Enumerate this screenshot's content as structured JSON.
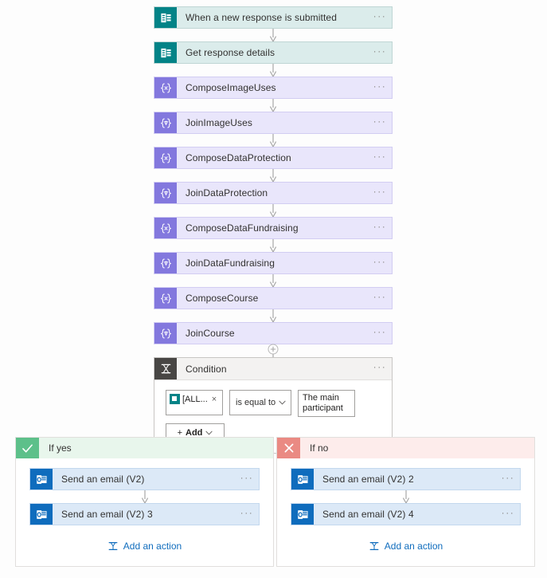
{
  "flow": {
    "steps": [
      {
        "label": "When a new response is submitted",
        "kind": "forms",
        "icon": "microsoft-forms-icon",
        "menu": "···"
      },
      {
        "label": "Get response details",
        "kind": "forms",
        "icon": "microsoft-forms-icon",
        "menu": "···"
      },
      {
        "label": "ComposeImageUses",
        "kind": "compose",
        "icon": "compose-icon",
        "menu": "···"
      },
      {
        "label": "JoinImageUses",
        "kind": "join",
        "icon": "join-icon",
        "menu": "···"
      },
      {
        "label": "ComposeDataProtection",
        "kind": "compose",
        "icon": "compose-icon",
        "menu": "···"
      },
      {
        "label": "JoinDataProtection",
        "kind": "join",
        "icon": "join-icon",
        "menu": "···"
      },
      {
        "label": "ComposeDataFundraising",
        "kind": "compose",
        "icon": "compose-icon",
        "menu": "···"
      },
      {
        "label": "JoinDataFundraising",
        "kind": "join",
        "icon": "join-icon",
        "menu": "···"
      },
      {
        "label": "ComposeCourse",
        "kind": "compose",
        "icon": "compose-icon",
        "menu": "···"
      },
      {
        "label": "JoinCourse",
        "kind": "join",
        "icon": "join-icon",
        "menu": "···"
      }
    ]
  },
  "condition": {
    "title": "Condition",
    "icon": "condition-icon",
    "menu": "···",
    "token": {
      "label": "[ALL...",
      "icon": "microsoft-forms-icon",
      "remove": "×"
    },
    "operator": {
      "value": "is equal to",
      "chevron": "chevron-down-icon"
    },
    "value": "The main participant",
    "add": {
      "plus": "+",
      "label": "Add",
      "chevron": "chevron-down-icon"
    }
  },
  "branches": {
    "yes": {
      "title": "If yes",
      "badge": "check-icon",
      "actions": [
        {
          "label": "Send an email (V2)",
          "icon": "outlook-icon",
          "menu": "···"
        },
        {
          "label": "Send an email (V2) 3",
          "icon": "outlook-icon",
          "menu": "···"
        }
      ],
      "add_action": "Add an action"
    },
    "no": {
      "title": "If no",
      "badge": "close-icon",
      "actions": [
        {
          "label": "Send an email (V2) 2",
          "icon": "outlook-icon",
          "menu": "···"
        },
        {
          "label": "Send an email (V2) 4",
          "icon": "outlook-icon",
          "menu": "···"
        }
      ],
      "add_action": "Add an action"
    }
  },
  "colors": {
    "forms": "#038387",
    "compose": "#8378de",
    "outlook": "#0f6cbd",
    "condition": "#484644",
    "yes": "#5dc08a",
    "no": "#ea8a83",
    "link": "#0f6cbd"
  }
}
